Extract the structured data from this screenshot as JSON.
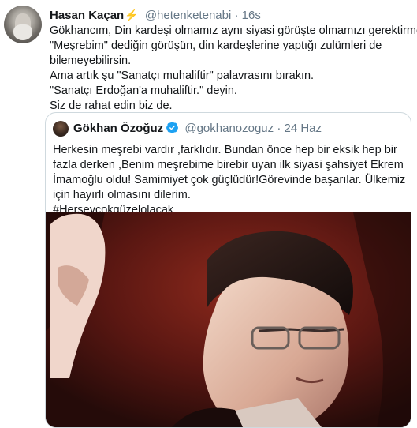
{
  "tweet": {
    "author_name": "Hasan Kaçan",
    "author_emoji": "⚡",
    "handle": "@hetenketenabi",
    "separator": "·",
    "time": "16s",
    "lines": [
      "Gökhancım, Din kardeşi olmamız aynı siyasi görüşte olmamızı gerektirmez.",
      "\"Meşrebim\" dediğin görüşün, din kardeşlerine yaptığı zulümleri de",
      "bilemeyebilirsin.",
      "Ama artık şu \"Sanatçı muhaliftir\" palavrasını bırakın.",
      "\"Sanatçı Erdoğan'a muhaliftir.\" deyin.",
      "Siz de rahat edin biz de."
    ]
  },
  "quoted": {
    "author_name": "Gökhan Özoğuz",
    "handle": "@gokhanozoguz",
    "separator": "·",
    "date": "24 Haz",
    "lines": [
      "Herkesin meşrebi vardır ,farklıdır. Bundan önce hep bir eksik hep bir",
      "fazla derken ,Benim meşrebime birebir uyan ilk siyasi şahsiyet Ekrem",
      "İmamoğlu oldu! Samimiyet çok güçlüdür!Görevinde başarılar. Ülkemiz",
      "için hayırlı olmasını dilerim.",
      "#Herşeyçokgüzelolacak"
    ],
    "image_description_icon": "portrait-photo"
  },
  "colors": {
    "text": "#14171a",
    "secondary": "#657786",
    "verified": "#1da1f2",
    "bolt": "#f5a623",
    "border": "#cfd9de"
  }
}
